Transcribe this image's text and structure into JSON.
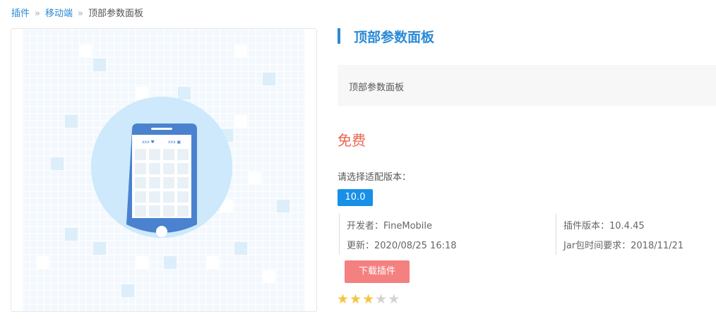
{
  "breadcrumb": {
    "item1": "插件",
    "item2": "移动端",
    "current": "顶部参数面板",
    "separator": "»"
  },
  "preview": {
    "phone_status_left": "xxx ♥",
    "phone_status_right": "xxx ▣",
    "colors": {
      "grid_bg": "#f2f8fd",
      "circle": "#cde9fb",
      "phone": "#4a82cf",
      "screen": "#ffffff",
      "cell": "#e9f1f7"
    }
  },
  "plugin": {
    "title": "顶部参数面板",
    "description": "顶部参数面板",
    "price": "免费",
    "choose_version_label": "请选择适配版本：",
    "version": "10.0",
    "developer": "开发者：FineMobile",
    "updated": "更新：2020/08/25 16:18",
    "plugin_version": "插件版本：10.4.45",
    "jar_requirement": "Jar包时间要求：2018/11/21",
    "download_label": "下载插件",
    "rating": 3,
    "max_rating": 5,
    "colors": {
      "accent": "#2b8ad6",
      "price": "#e8664f",
      "version_button": "#1890e8",
      "download_button": "#f48080",
      "star_on": "#f5c542",
      "star_off": "#d3d3d3"
    }
  }
}
